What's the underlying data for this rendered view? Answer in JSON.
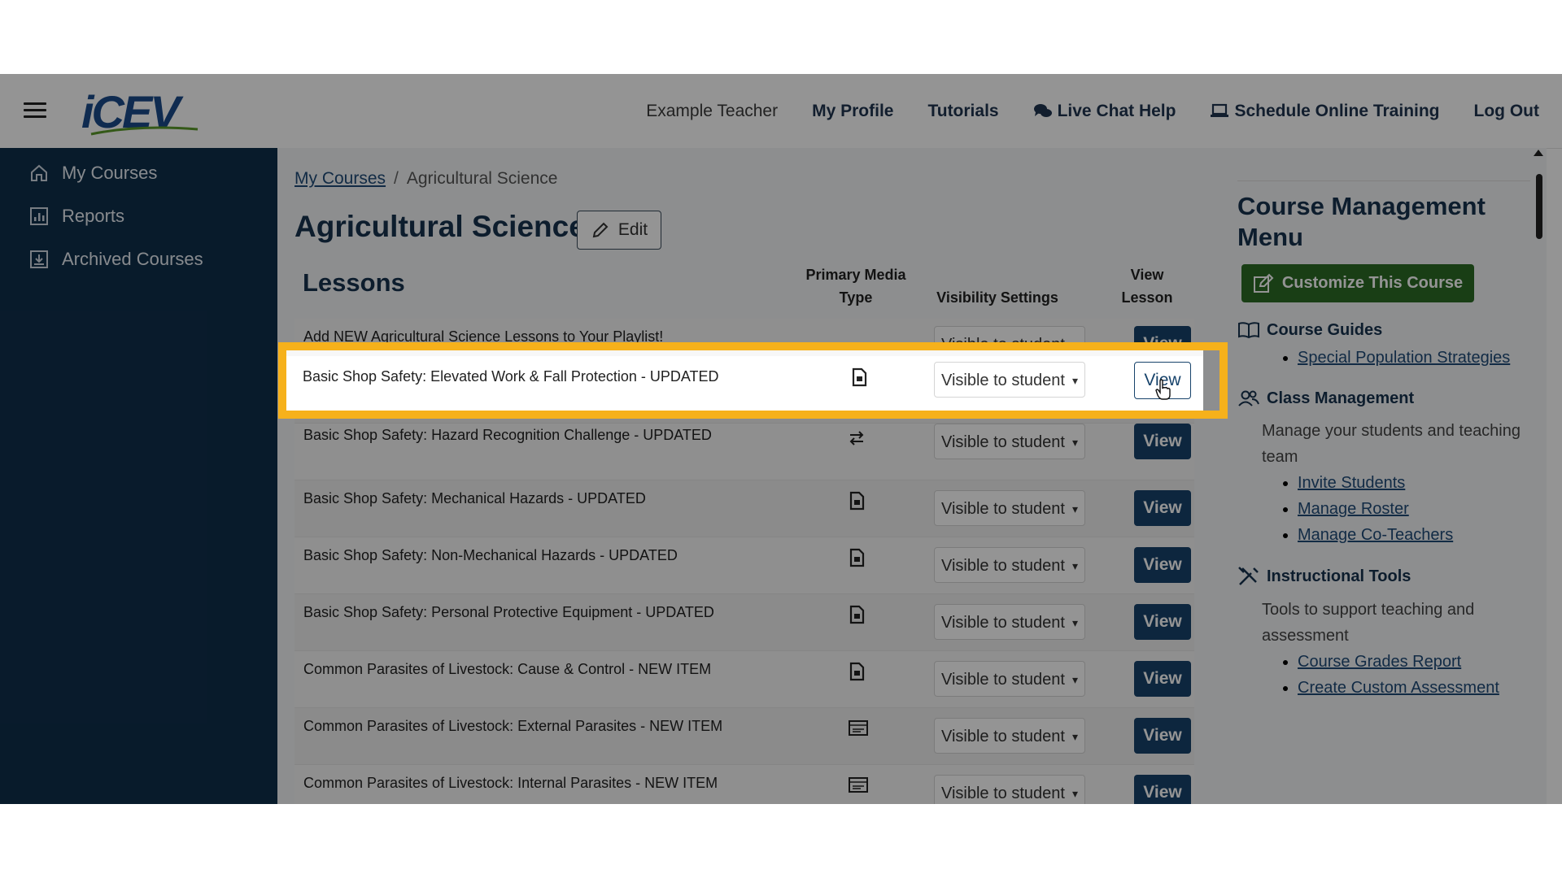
{
  "header": {
    "user_name": "Example Teacher",
    "nav": [
      "My Profile",
      "Tutorials",
      "Live Chat Help",
      "Schedule Online Training",
      "Log Out"
    ],
    "logo_text": "iCEV"
  },
  "sidebar": {
    "items": [
      {
        "label": "My Courses",
        "icon": "home-icon"
      },
      {
        "label": "Reports",
        "icon": "reports-icon"
      },
      {
        "label": "Archived Courses",
        "icon": "archive-icon"
      }
    ]
  },
  "breadcrumb": {
    "link": "My Courses",
    "separator": "/",
    "current": "Agricultural Science"
  },
  "page": {
    "title": "Agricultural Science",
    "edit_label": "Edit"
  },
  "lessons": {
    "heading": "Lessons",
    "columns": {
      "media": "Primary Media Type",
      "visibility": "Visibility Settings",
      "view": "View Lesson"
    },
    "rows": [
      {
        "name": "Add NEW Agricultural Science Lessons to Your Playlist!",
        "media": "",
        "visibility": "Visible to student",
        "view": "View"
      },
      {
        "name": "Basic Shop Safety: Elevated Work & Fall Protection - UPDATED",
        "media": "document-icon",
        "visibility": "Visible to student",
        "view": "View"
      },
      {
        "name": "Basic Shop Safety: Hazard Recognition Challenge - UPDATED",
        "media": "interactive-icon",
        "visibility": "Visible to student",
        "view": "View"
      },
      {
        "name": "Basic Shop Safety: Mechanical Hazards - UPDATED",
        "media": "document-icon",
        "visibility": "Visible to student",
        "view": "View"
      },
      {
        "name": "Basic Shop Safety: Non-Mechanical Hazards - UPDATED",
        "media": "document-icon",
        "visibility": "Visible to student",
        "view": "View"
      },
      {
        "name": "Basic Shop Safety: Personal Protective Equipment - UPDATED",
        "media": "document-icon",
        "visibility": "Visible to student",
        "view": "View"
      },
      {
        "name": "Common Parasites of Livestock: Cause & Control - NEW ITEM",
        "media": "document-icon",
        "visibility": "Visible to student",
        "view": "View"
      },
      {
        "name": "Common Parasites of Livestock: External Parasites - NEW ITEM",
        "media": "slides-icon",
        "visibility": "Visible to student",
        "view": "View"
      },
      {
        "name": "Common Parasites of Livestock: Internal Parasites - NEW ITEM",
        "media": "slides-icon",
        "visibility": "Visible to student",
        "view": "View"
      }
    ]
  },
  "course_menu": {
    "title": "Course Management Menu",
    "customize_label": "Customize This Course",
    "guides": {
      "title": "Course Guides",
      "links": [
        "Special Population Strategies"
      ]
    },
    "class_mgmt": {
      "title": "Class Management",
      "desc": "Manage your students and teaching team",
      "links": [
        "Invite Students",
        "Manage Roster",
        "Manage Co-Teachers"
      ]
    },
    "tools": {
      "title": "Instructional Tools",
      "desc": "Tools to support teaching and assessment",
      "links": [
        "Course Grades Report",
        "Create Custom Assessment"
      ]
    }
  },
  "colors": {
    "sidebar": "#0f2f4b",
    "primary": "#17436b",
    "accent_green": "#2c6b25",
    "highlight": "#f6b11b"
  }
}
